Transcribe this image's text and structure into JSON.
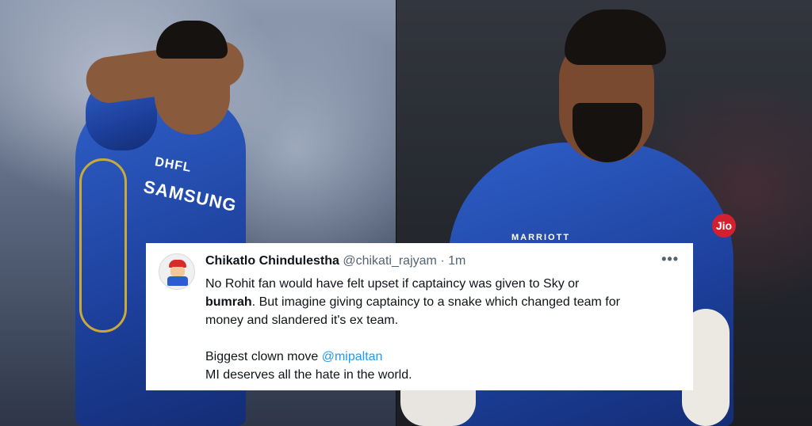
{
  "tweet": {
    "display_name": "Chikatlo Chindulestha",
    "handle": "@chikati_rajyam",
    "separator": "·",
    "time": "1m",
    "more_icon": "more-horizontal-icon",
    "line1_pre": "No Rohit fan would have felt upset if captaincy was given to Sky or",
    "line2_bold": "bumrah",
    "line2_rest": ". But imagine giving captaincy to a snake which changed team for",
    "line3": "money and slandered it's ex team.",
    "line4_pre": "Biggest clown move ",
    "line4_mention": "@mipaltan",
    "line5": "MI deserves all the hate in the world."
  },
  "colors": {
    "mention": "#1d9bf0",
    "text": "#0f1419",
    "muted": "#536471",
    "jersey": "#1c3f9a"
  },
  "photos": {
    "left_jersey_text": "SAMSUNG",
    "left_jersey_text2": "DHFL",
    "right_jersey_text": "MARRIOTT",
    "right_sleeve_text": "Jio"
  }
}
